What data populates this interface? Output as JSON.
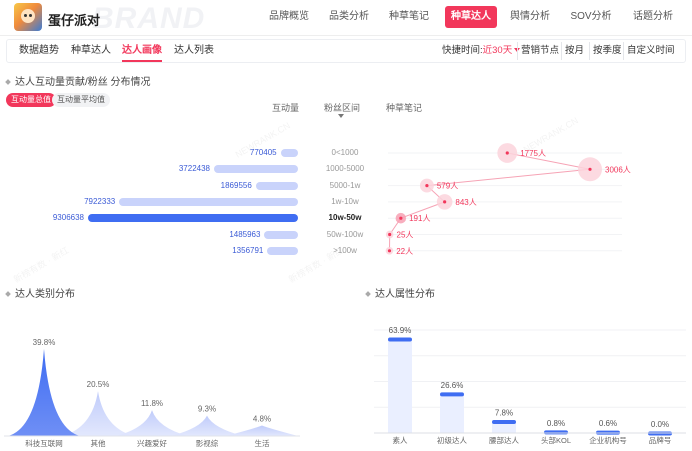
{
  "header": {
    "brand_name": "蛋仔派对",
    "brand_watermark": "BRAND",
    "nav": [
      {
        "label": "品牌概览",
        "active": false
      },
      {
        "label": "品类分析",
        "active": false
      },
      {
        "label": "种草笔记",
        "active": false
      },
      {
        "label": "种草达人",
        "active": true
      },
      {
        "label": "舆情分析",
        "active": false
      },
      {
        "label": "SOV分析",
        "active": false
      },
      {
        "label": "话题分析",
        "active": false
      }
    ]
  },
  "subnav": {
    "tabs": [
      {
        "label": "数据趋势",
        "active": false
      },
      {
        "label": "种草达人",
        "active": false
      },
      {
        "label": "达人画像",
        "active": true
      },
      {
        "label": "达人列表",
        "active": false
      }
    ],
    "quick_time_label": "快捷时间:",
    "quick_time_value": "近30天",
    "time_options": [
      "营销节点",
      "按月",
      "按季度",
      "自定义时间"
    ]
  },
  "contribution": {
    "title": "达人互动量贡献/粉丝 分布情况",
    "toggles": [
      {
        "label": "互动量总值",
        "active": true
      },
      {
        "label": "互动量平均值",
        "active": false
      }
    ],
    "col_interaction": "互动量",
    "col_fans": "粉丝区间",
    "col_influencers": "种草笔记",
    "rows": [
      {
        "range": "0<1000",
        "interaction": "770405",
        "value": 770405,
        "count": "1775人",
        "count_value": 1775
      },
      {
        "range": "1000-5000",
        "interaction": "3722438",
        "value": 3722438,
        "count": "3006人",
        "count_value": 3006
      },
      {
        "range": "5000-1w",
        "interaction": "1869556",
        "value": 1869556,
        "count": "579人",
        "count_value": 579
      },
      {
        "range": "1w-10w",
        "interaction": "7922333",
        "value": 7922333,
        "count": "843人",
        "count_value": 843
      },
      {
        "range": "10w-50w",
        "interaction": "9306638",
        "value": 9306638,
        "count": "191人",
        "count_value": 191,
        "highlight": true
      },
      {
        "range": "50w-100w",
        "interaction": "1485963",
        "value": 1485963,
        "count": "25人",
        "count_value": 25
      },
      {
        "range": ">100w",
        "interaction": "1356791",
        "value": 1356791,
        "count": "22人",
        "count_value": 22
      }
    ]
  },
  "category": {
    "title": "达人类别分布"
  },
  "attribute": {
    "title": "达人属性分布"
  },
  "chart_data": [
    {
      "type": "area",
      "categories": [
        "科技互联网",
        "其他",
        "兴趣爱好",
        "影视综",
        "生活"
      ],
      "values": [
        39.8,
        20.5,
        11.8,
        9.3,
        4.8
      ],
      "value_labels": [
        "39.8%",
        "20.5%",
        "11.8%",
        "9.3%",
        "4.8%"
      ],
      "ylim": [
        0,
        42
      ],
      "colors": [
        "#3f6df2",
        "#c9d3fb"
      ]
    },
    {
      "type": "bar",
      "categories": [
        "素人",
        "初级达人",
        "腰部达人",
        "头部KOL",
        "企业机构号",
        "品牌号"
      ],
      "values": [
        63.9,
        26.6,
        7.8,
        0.8,
        0.6,
        0.0
      ],
      "value_labels": [
        "63.9%",
        "26.6%",
        "7.8%",
        "0.8%",
        "0.6%",
        "0.0%"
      ],
      "ylim": [
        0,
        70
      ],
      "grid": true,
      "colors": [
        "#eaefff",
        "#3f6df2"
      ]
    }
  ],
  "watermarks": [
    "新榜有数 · 新红",
    "NEWRANK.CN"
  ]
}
